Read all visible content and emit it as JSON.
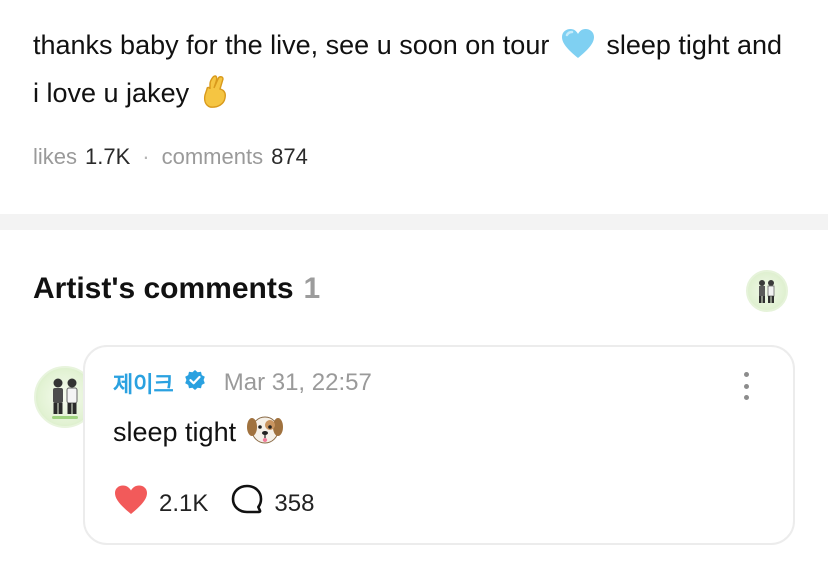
{
  "post": {
    "text_part1": "thanks baby for the live, see u soon on tour",
    "text_part2": "sleep tight and i love u jakey",
    "emoji1": "blue-heart",
    "emoji2": "crossed-fingers"
  },
  "stats": {
    "likes_label": "likes",
    "likes_value": "1.7K",
    "separator": "·",
    "comments_label": "comments",
    "comments_value": "874"
  },
  "artist_comments": {
    "title": "Artist's comments",
    "count": "1"
  },
  "comment": {
    "author": "제이크",
    "verified_icon": "verified-badge-icon",
    "timestamp": "Mar 31, 22:57",
    "text": "sleep tight",
    "emoji": "dog-face",
    "likes": "2.1K",
    "replies": "358"
  },
  "colors": {
    "author_blue": "#2aa1e0",
    "like_red": "#f25a5a",
    "muted_gray": "#9a9a9a",
    "divider": "#f3f3f3"
  }
}
